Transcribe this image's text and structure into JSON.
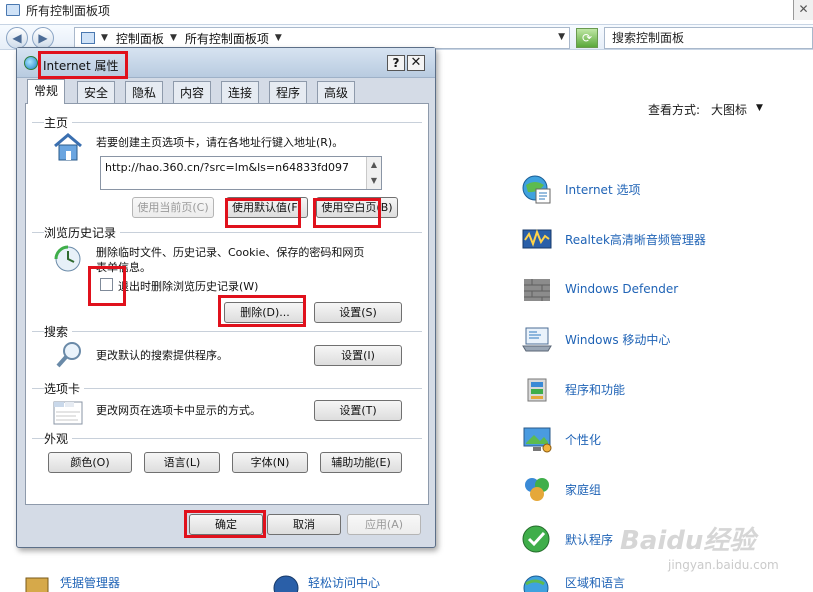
{
  "window": {
    "title": "所有控制面板项"
  },
  "address": {
    "breadcrumbs": [
      "控制面板",
      "所有控制面板项"
    ],
    "search_placeholder": "搜索控制面板"
  },
  "view": {
    "label": "查看方式:",
    "value": "大图标"
  },
  "control_panel_items": [
    {
      "label": "Internet 选项",
      "icon": "internet-options-icon"
    },
    {
      "label": "Realtek高清晰音频管理器",
      "icon": "realtek-audio-icon"
    },
    {
      "label": "Windows Defender",
      "icon": "windows-defender-icon"
    },
    {
      "label": "Windows 移动中心",
      "icon": "mobility-center-icon"
    },
    {
      "label": "程序和功能",
      "icon": "programs-features-icon"
    },
    {
      "label": "个性化",
      "icon": "personalization-icon"
    },
    {
      "label": "家庭组",
      "icon": "homegroup-icon"
    },
    {
      "label": "默认程序",
      "icon": "default-programs-icon"
    },
    {
      "label": "区域和语言",
      "icon": "region-language-icon"
    }
  ],
  "bottom_items": [
    {
      "label": "凭据管理器",
      "icon": "credential-manager-icon"
    },
    {
      "label": "轻松访问中心",
      "icon": "ease-of-access-icon"
    }
  ],
  "dialog": {
    "title": "Internet 属性",
    "help": "?",
    "close": "✕",
    "tabs": [
      "常规",
      "安全",
      "隐私",
      "内容",
      "连接",
      "程序",
      "高级"
    ],
    "home": {
      "section": "主页",
      "description": "若要创建主页选项卡，请在各地址行键入地址(R)。",
      "url": "http://hao.360.cn/?src=lm&ls=n64833fd097",
      "use_current": "使用当前页(C)",
      "use_default": "使用默认值(F)",
      "use_blank": "使用空白页(B)"
    },
    "history": {
      "section": "浏览历史记录",
      "description_line1": "删除临时文件、历史记录、Cookie、保存的密码和网页",
      "description_line2": "表单信息。",
      "checkbox_label": "退出时删除浏览历史记录(W)",
      "delete_button": "删除(D)...",
      "settings_button": "设置(S)"
    },
    "search": {
      "section": "搜索",
      "description": "更改默认的搜索提供程序。",
      "settings_button": "设置(I)"
    },
    "tabs_section": {
      "section": "选项卡",
      "description": "更改网页在选项卡中显示的方式。",
      "settings_button": "设置(T)"
    },
    "appearance": {
      "section": "外观",
      "colors": "颜色(O)",
      "languages": "语言(L)",
      "fonts": "字体(N)",
      "accessibility": "辅助功能(E)"
    },
    "footer": {
      "ok": "确定",
      "cancel": "取消",
      "apply": "应用(A)"
    }
  },
  "watermark": {
    "brand": "Baidu经验",
    "url": "jingyan.baidu.com"
  },
  "colors": {
    "highlight": "#e0111c",
    "link": "#1f63b6"
  }
}
